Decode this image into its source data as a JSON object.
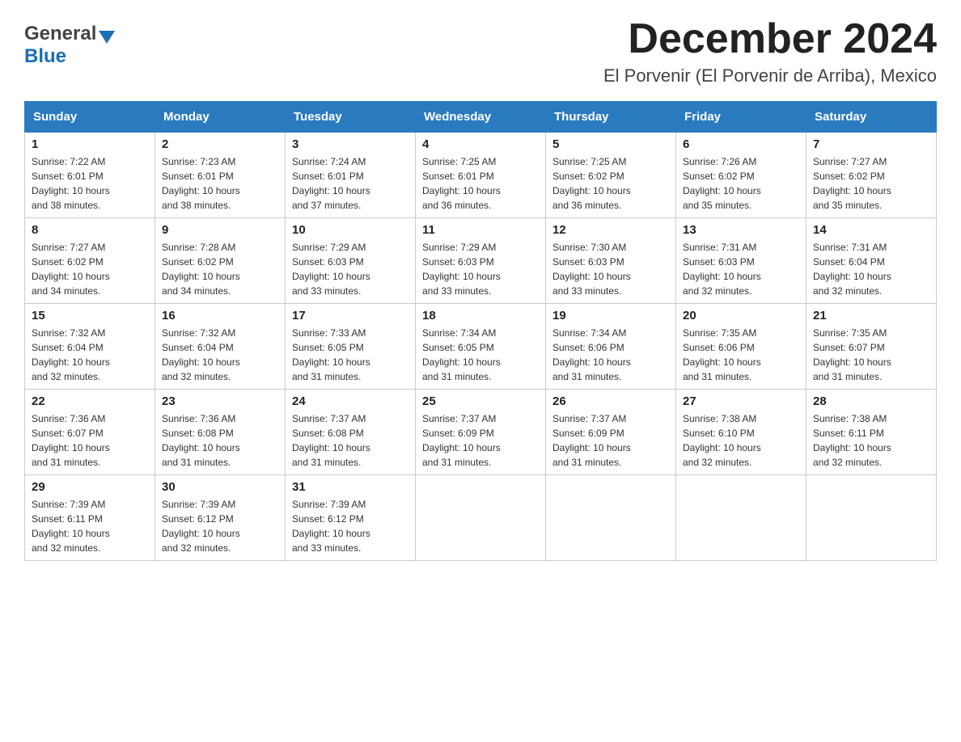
{
  "header": {
    "logo_general": "General",
    "logo_blue": "Blue",
    "month_title": "December 2024",
    "location": "El Porvenir (El Porvenir de Arriba), Mexico"
  },
  "days_of_week": [
    "Sunday",
    "Monday",
    "Tuesday",
    "Wednesday",
    "Thursday",
    "Friday",
    "Saturday"
  ],
  "weeks": [
    [
      {
        "day": "1",
        "sunrise": "7:22 AM",
        "sunset": "6:01 PM",
        "daylight": "10 hours and 38 minutes."
      },
      {
        "day": "2",
        "sunrise": "7:23 AM",
        "sunset": "6:01 PM",
        "daylight": "10 hours and 38 minutes."
      },
      {
        "day": "3",
        "sunrise": "7:24 AM",
        "sunset": "6:01 PM",
        "daylight": "10 hours and 37 minutes."
      },
      {
        "day": "4",
        "sunrise": "7:25 AM",
        "sunset": "6:01 PM",
        "daylight": "10 hours and 36 minutes."
      },
      {
        "day": "5",
        "sunrise": "7:25 AM",
        "sunset": "6:02 PM",
        "daylight": "10 hours and 36 minutes."
      },
      {
        "day": "6",
        "sunrise": "7:26 AM",
        "sunset": "6:02 PM",
        "daylight": "10 hours and 35 minutes."
      },
      {
        "day": "7",
        "sunrise": "7:27 AM",
        "sunset": "6:02 PM",
        "daylight": "10 hours and 35 minutes."
      }
    ],
    [
      {
        "day": "8",
        "sunrise": "7:27 AM",
        "sunset": "6:02 PM",
        "daylight": "10 hours and 34 minutes."
      },
      {
        "day": "9",
        "sunrise": "7:28 AM",
        "sunset": "6:02 PM",
        "daylight": "10 hours and 34 minutes."
      },
      {
        "day": "10",
        "sunrise": "7:29 AM",
        "sunset": "6:03 PM",
        "daylight": "10 hours and 33 minutes."
      },
      {
        "day": "11",
        "sunrise": "7:29 AM",
        "sunset": "6:03 PM",
        "daylight": "10 hours and 33 minutes."
      },
      {
        "day": "12",
        "sunrise": "7:30 AM",
        "sunset": "6:03 PM",
        "daylight": "10 hours and 33 minutes."
      },
      {
        "day": "13",
        "sunrise": "7:31 AM",
        "sunset": "6:03 PM",
        "daylight": "10 hours and 32 minutes."
      },
      {
        "day": "14",
        "sunrise": "7:31 AM",
        "sunset": "6:04 PM",
        "daylight": "10 hours and 32 minutes."
      }
    ],
    [
      {
        "day": "15",
        "sunrise": "7:32 AM",
        "sunset": "6:04 PM",
        "daylight": "10 hours and 32 minutes."
      },
      {
        "day": "16",
        "sunrise": "7:32 AM",
        "sunset": "6:04 PM",
        "daylight": "10 hours and 32 minutes."
      },
      {
        "day": "17",
        "sunrise": "7:33 AM",
        "sunset": "6:05 PM",
        "daylight": "10 hours and 31 minutes."
      },
      {
        "day": "18",
        "sunrise": "7:34 AM",
        "sunset": "6:05 PM",
        "daylight": "10 hours and 31 minutes."
      },
      {
        "day": "19",
        "sunrise": "7:34 AM",
        "sunset": "6:06 PM",
        "daylight": "10 hours and 31 minutes."
      },
      {
        "day": "20",
        "sunrise": "7:35 AM",
        "sunset": "6:06 PM",
        "daylight": "10 hours and 31 minutes."
      },
      {
        "day": "21",
        "sunrise": "7:35 AM",
        "sunset": "6:07 PM",
        "daylight": "10 hours and 31 minutes."
      }
    ],
    [
      {
        "day": "22",
        "sunrise": "7:36 AM",
        "sunset": "6:07 PM",
        "daylight": "10 hours and 31 minutes."
      },
      {
        "day": "23",
        "sunrise": "7:36 AM",
        "sunset": "6:08 PM",
        "daylight": "10 hours and 31 minutes."
      },
      {
        "day": "24",
        "sunrise": "7:37 AM",
        "sunset": "6:08 PM",
        "daylight": "10 hours and 31 minutes."
      },
      {
        "day": "25",
        "sunrise": "7:37 AM",
        "sunset": "6:09 PM",
        "daylight": "10 hours and 31 minutes."
      },
      {
        "day": "26",
        "sunrise": "7:37 AM",
        "sunset": "6:09 PM",
        "daylight": "10 hours and 31 minutes."
      },
      {
        "day": "27",
        "sunrise": "7:38 AM",
        "sunset": "6:10 PM",
        "daylight": "10 hours and 32 minutes."
      },
      {
        "day": "28",
        "sunrise": "7:38 AM",
        "sunset": "6:11 PM",
        "daylight": "10 hours and 32 minutes."
      }
    ],
    [
      {
        "day": "29",
        "sunrise": "7:39 AM",
        "sunset": "6:11 PM",
        "daylight": "10 hours and 32 minutes."
      },
      {
        "day": "30",
        "sunrise": "7:39 AM",
        "sunset": "6:12 PM",
        "daylight": "10 hours and 32 minutes."
      },
      {
        "day": "31",
        "sunrise": "7:39 AM",
        "sunset": "6:12 PM",
        "daylight": "10 hours and 33 minutes."
      },
      null,
      null,
      null,
      null
    ]
  ],
  "labels": {
    "sunrise": "Sunrise:",
    "sunset": "Sunset:",
    "daylight": "Daylight:"
  }
}
